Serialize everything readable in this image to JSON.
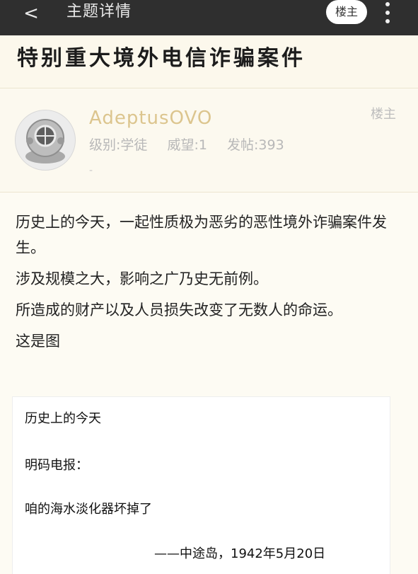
{
  "topbar": {
    "back_icon": "chevron-left-icon",
    "back_glyph": "<",
    "title": "主题详情",
    "owner_button": "楼主",
    "more_icon": "more-vertical-icon"
  },
  "thread": {
    "title": "特别重大境外电信诈骗案件"
  },
  "author": {
    "username": "AdeptusOVO",
    "tag": "楼主",
    "level": "级别:学徒",
    "prestige": "威望:1",
    "posts": "发帖:393",
    "dash": "-",
    "avatar_icon": "diving-helmet-avatar-icon"
  },
  "post": {
    "paragraphs": [
      "历史上的今天，一起性质极为恶劣的恶性境外诈骗案件发生。",
      "涉及规模之大，影响之广乃史无前例。",
      "所造成的财产以及人员损失改变了无数人的命运。",
      "这是图"
    ],
    "image": {
      "line1": "历史上的今天",
      "line2": "明码电报：",
      "line3": "咱的海水淡化器坏掉了",
      "signature": "——中途岛，1942年5月20日"
    }
  },
  "colors": {
    "topbar_bg": "#2f2f2f",
    "username": "#dcc58e",
    "page_bg": "#fdfbf3"
  }
}
